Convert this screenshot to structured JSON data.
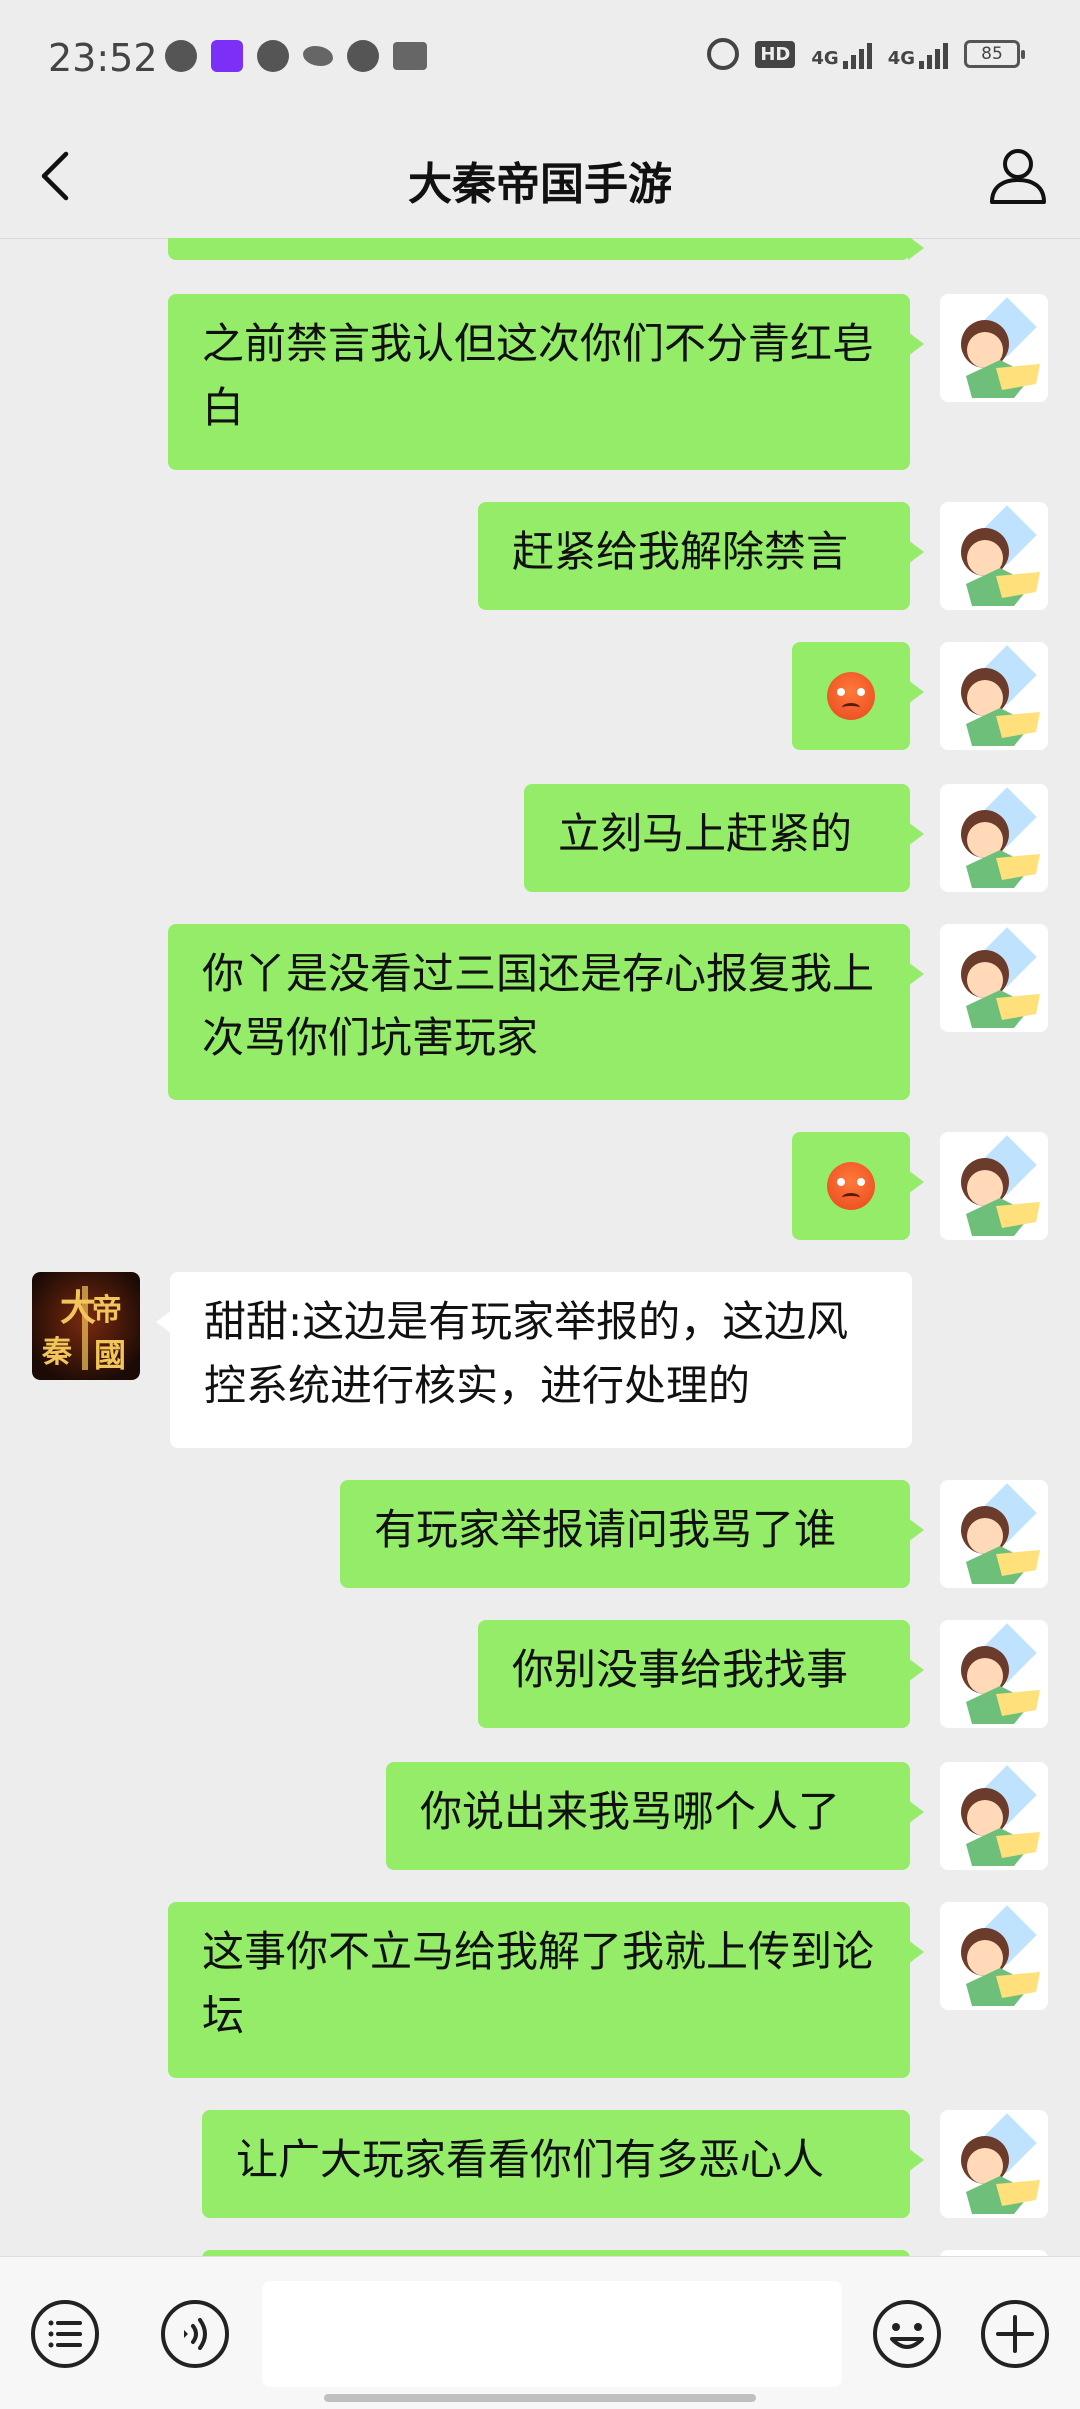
{
  "status_bar": {
    "time": "23:52",
    "right_icons": [
      "alarm-icon",
      "hd-icon",
      "signal-4g-icon",
      "signal-4g-icon"
    ],
    "network_1": "4G",
    "network_2": "4G",
    "hd": "HD",
    "battery": "85"
  },
  "header": {
    "title": "大秦帝国手游"
  },
  "messages": [
    {
      "from": "me",
      "type": "text",
      "text": "之前禁言我认但这次你们不分青红皂白"
    },
    {
      "from": "me",
      "type": "text",
      "text": "赶紧给我解除禁言"
    },
    {
      "from": "me",
      "type": "emoji",
      "emoji": "angry-face-emoji"
    },
    {
      "from": "me",
      "type": "text",
      "text": "立刻马上赶紧的"
    },
    {
      "from": "me",
      "type": "text",
      "text": "你丫是没看过三国还是存心报复我上次骂你们坑害玩家"
    },
    {
      "from": "me",
      "type": "emoji",
      "emoji": "angry-face-emoji"
    },
    {
      "from": "other",
      "type": "text",
      "text": "甜甜:这边是有玩家举报的，这边风控系统进行核实，进行处理的"
    },
    {
      "from": "me",
      "type": "text",
      "text": "有玩家举报请问我骂了谁"
    },
    {
      "from": "me",
      "type": "text",
      "text": "你别没事给我找事"
    },
    {
      "from": "me",
      "type": "text",
      "text": "你说出来我骂哪个人了"
    },
    {
      "from": "me",
      "type": "text",
      "text": "这事你不立马给我解了我就上传到论坛"
    },
    {
      "from": "me",
      "type": "text",
      "text": "让广大玩家看看你们有多恶心人"
    }
  ],
  "other_avatar_text": "大秦帝国",
  "input_bar": {
    "placeholder": "",
    "icons": [
      "menu-icon",
      "voice-icon",
      "emoji-icon",
      "plus-icon"
    ]
  },
  "colors": {
    "background": "#ededed",
    "my_bubble": "#95ec69",
    "other_bubble": "#ffffff",
    "input_bar": "#f7f7f7"
  }
}
